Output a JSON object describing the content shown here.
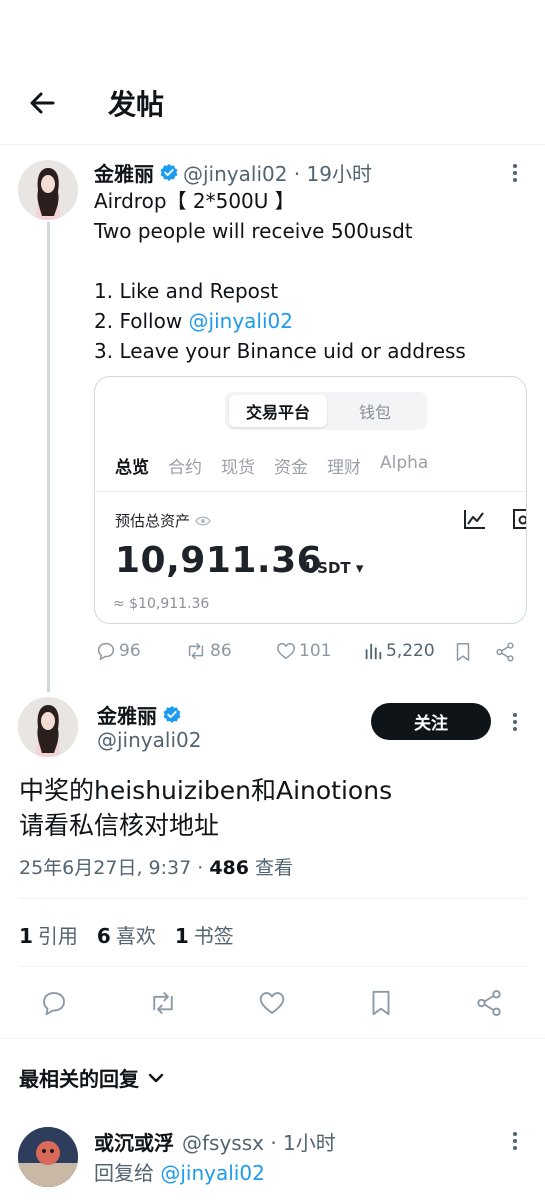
{
  "header": {
    "title": "发帖"
  },
  "original_post": {
    "author_name": "金雅丽",
    "handle_time": "@jinyali02 · 19小时",
    "lines": [
      "Airdrop【 2*500U 】",
      "Two people will receive 500usdt",
      "1. Like and Repost"
    ],
    "follow_prefix": "2. Follow ",
    "follow_handle": "@jinyali02",
    "last_line": "3. Leave your Binance uid or address",
    "card": {
      "seg_active": "交易平台",
      "seg_inactive": "钱包",
      "tabs": [
        "总览",
        "合约",
        "现货",
        "资金",
        "理财",
        "Alpha"
      ],
      "asset_label": "预估总资产",
      "asset_value": "10,911.36",
      "asset_unit": "USDT ▾",
      "asset_approx": "≈ $10,911.36"
    },
    "metrics": {
      "replies": "96",
      "reposts": "86",
      "likes": "101",
      "views": "5,220"
    }
  },
  "reply_post": {
    "author_name": "金雅丽",
    "handle": "@jinyali02",
    "follow_label": "关注",
    "text": "中奖的heishuiziben和Ainotions\n请看私信核对地址",
    "date": "25年6月27日, 9:37 · ",
    "view_count": "486",
    "view_label": " 查看",
    "stats": {
      "quotes_count": "1",
      "quotes_label": "引用",
      "likes_count": "6",
      "likes_label": "喜欢",
      "bookmarks_count": "1",
      "bookmarks_label": "书签"
    }
  },
  "replies_section": {
    "sort_label": "最相关的回复"
  },
  "next_reply": {
    "author_name": "或沉或浮",
    "handle_time": "@fsyssx · 1小时",
    "reply_prefix": "回复给 ",
    "reply_to": "@jinyali02"
  },
  "colors": {
    "accent": "#1d9bf0",
    "text": "#0f1419",
    "muted": "#536471",
    "button": "#0f1419"
  }
}
